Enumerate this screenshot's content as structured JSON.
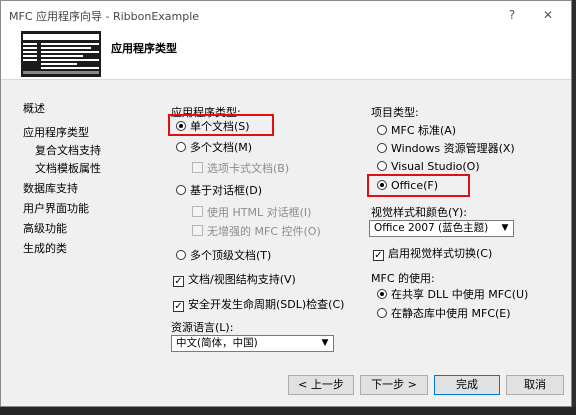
{
  "window": {
    "title": "MFC 应用程序向导 - RibbonExample",
    "help_label": "?",
    "close_label": "✕"
  },
  "banner": {
    "title": "应用程序类型"
  },
  "nav": {
    "items": [
      "概述",
      "应用程序类型",
      "复合文档支持",
      "文档模板属性",
      "数据库支持",
      "用户界面功能",
      "高级功能",
      "生成的类"
    ]
  },
  "app_type": {
    "label": "应用程序类型:",
    "single_doc": "单个文档(S)",
    "multi_doc": "多个文档(M)",
    "tabbed_docs": "选项卡式文档(B)",
    "dialog_based": "基于对话框(D)",
    "html_dialog": "使用 HTML 对话框(I)",
    "no_enhanced_mfc": "无增强的 MFC 控件(O)",
    "multi_toplevel": "多个顶级文档(T)",
    "docview_support": "文档/视图结构支持(V)",
    "sdl_checks": "安全开发生命周期(SDL)检查(C)",
    "resource_lang_label": "资源语言(L):",
    "resource_lang_value": "中文(简体，中国)"
  },
  "project_type": {
    "label": "项目类型:",
    "mfc_standard": "MFC 标准(A)",
    "windows_explorer": "Windows 资源管理器(X)",
    "visual_studio": "Visual Studio(O)",
    "office": "Office(F)"
  },
  "visual_style": {
    "label": "视觉样式和颜色(Y):",
    "value": "Office 2007 (蓝色主题)",
    "enable_switch": "启用视觉样式切换(C)"
  },
  "mfc_use": {
    "label": "MFC 的使用:",
    "shared_dll": "在共享 DLL 中使用 MFC(U)",
    "static_lib": "在静态库中使用 MFC(E)"
  },
  "buttons": {
    "prev": "< 上一步",
    "next": "下一步 >",
    "finish": "完成",
    "cancel": "取消"
  },
  "colors": {
    "highlight": "#e01010",
    "accent": "#0078d7"
  }
}
